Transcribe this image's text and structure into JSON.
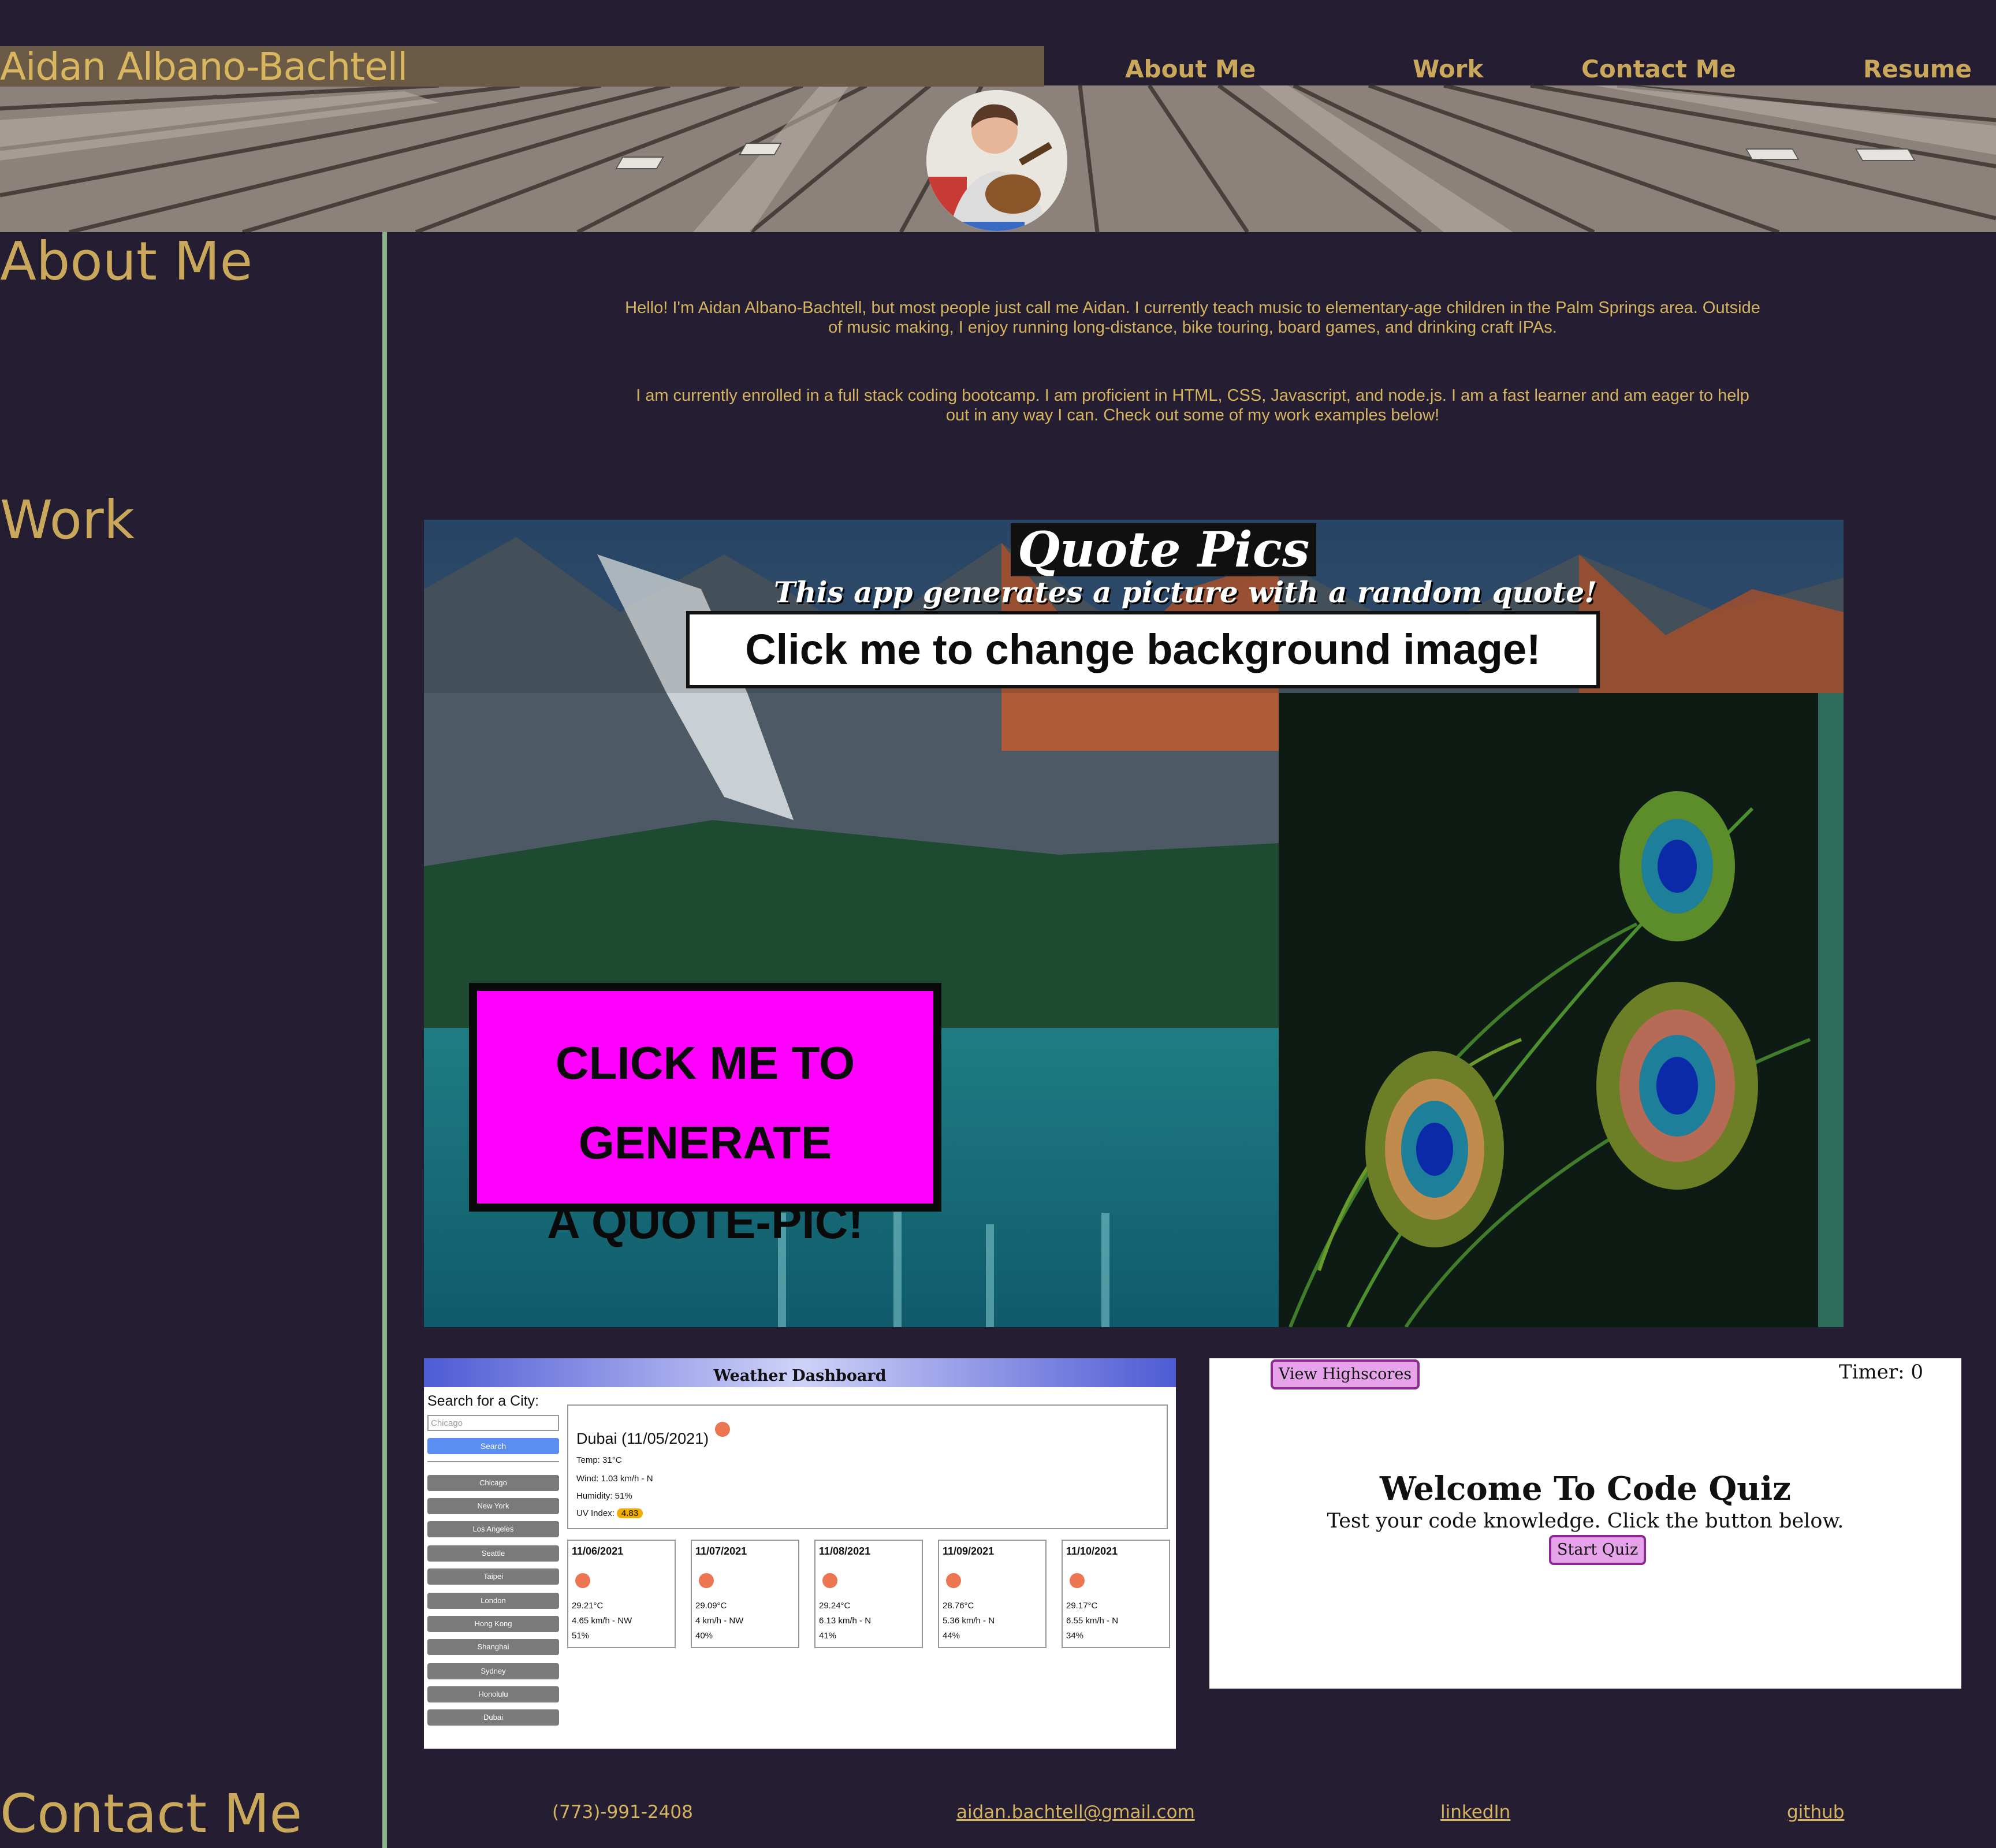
{
  "header": {
    "site_name": "Aidan Albano-Bachtell",
    "nav": [
      "About Me",
      "Work",
      "Contact Me",
      "Resume"
    ]
  },
  "sections": {
    "about_title": "About Me",
    "work_title": "Work",
    "contact_title": "Contact Me"
  },
  "about": {
    "paragraph1": "Hello! I'm Aidan Albano-Bachtell, but most people just call me Aidan. I currently teach music to elementary-age children in the Palm Springs area. Outside of music making, I enjoy running long-distance, bike touring, board games, and drinking craft IPAs.",
    "paragraph2": "I am currently enrolled in a full stack coding bootcamp. I am proficient in HTML, CSS, Javascript, and node.js. I am a fast learner and am eager to help out in any way I can. Check out some of my work examples below!"
  },
  "work": {
    "quote_pics": {
      "title": "Quote Pics",
      "subtitle": "This app generates a picture with a random quote!",
      "bg_button": "Click me to change background image!",
      "gen_button_line1": "CLICK ME TO GENERATE",
      "gen_button_line2": "A QUOTE-PIC!"
    },
    "weather": {
      "title": "Weather Dashboard",
      "search_label": "Search for a City:",
      "search_placeholder": "Chicago",
      "search_button": "Search",
      "cities": [
        "Chicago",
        "New York",
        "Los Angeles",
        "Seattle",
        "Taipei",
        "London",
        "Hong Kong",
        "Shanghai",
        "Sydney",
        "Honolulu",
        "Dubai"
      ],
      "current": {
        "title": "Dubai (11/05/2021)",
        "temp": "Temp: 31°C",
        "wind": "Wind: 1.03 km/h - N",
        "humidity": "Humidity: 51%",
        "uv_label": "UV Index:",
        "uv_value": "4.83"
      },
      "forecast": [
        {
          "date": "11/06/2021",
          "temp": "29.21°C",
          "wind": "4.65 km/h - NW",
          "humidity": "51%"
        },
        {
          "date": "11/07/2021",
          "temp": "29.09°C",
          "wind": "4 km/h - NW",
          "humidity": "40%"
        },
        {
          "date": "11/08/2021",
          "temp": "29.24°C",
          "wind": "6.13 km/h - N",
          "humidity": "41%"
        },
        {
          "date": "11/09/2021",
          "temp": "28.76°C",
          "wind": "5.36 km/h - N",
          "humidity": "44%"
        },
        {
          "date": "11/10/2021",
          "temp": "29.17°C",
          "wind": "6.55 km/h - N",
          "humidity": "34%"
        }
      ]
    },
    "quiz": {
      "highscores_button": "View Highscores",
      "timer": "Timer: 0",
      "title": "Welcome To Code Quiz",
      "subtitle": "Test your code knowledge. Click the button below.",
      "start_button": "Start Quiz"
    }
  },
  "contact": {
    "phone": "(773)-991-2408",
    "email": "aidan.bachtell@gmail.com",
    "linkedin": "linkedIn",
    "github": "github"
  },
  "colors": {
    "background": "#251d31",
    "accent_text": "#c9a85b",
    "divider": "#8ab58c",
    "name_bar": "#6b5a45",
    "quote_button": "#ff00ff",
    "quiz_button": "#e6a3ea"
  },
  "icons": {
    "weather_current": "sun-icon",
    "weather_forecast": "sun-icon"
  }
}
